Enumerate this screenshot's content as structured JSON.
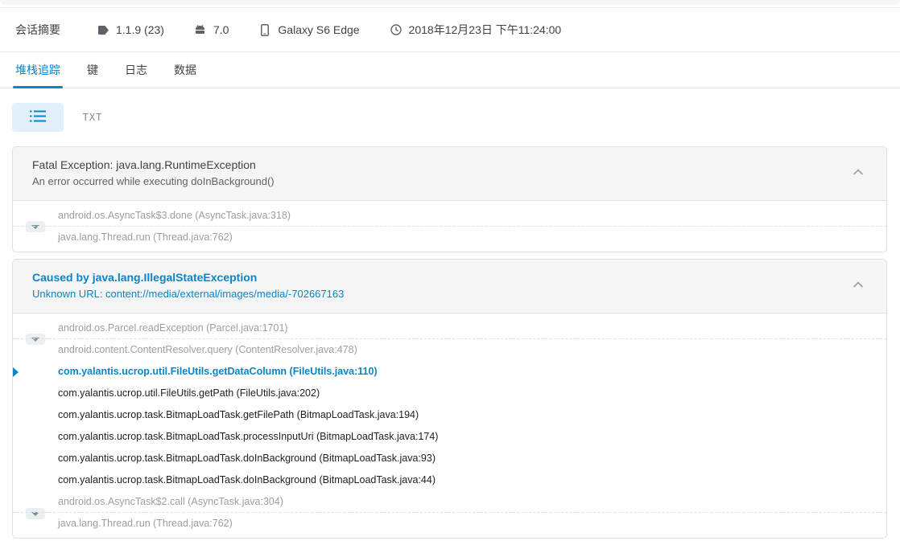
{
  "summary": {
    "title": "会话摘要",
    "version": "1.1.9 (23)",
    "os_version": "7.0",
    "device": "Galaxy S6 Edge",
    "datetime": "2018年12月23日 下午11:24:00",
    "icons": {
      "version": "tag-icon",
      "os": "android-icon",
      "device": "phone-icon",
      "time": "clock-icon"
    }
  },
  "tabs": [
    {
      "label": "堆栈追踪",
      "active": true
    },
    {
      "label": "键"
    },
    {
      "label": "日志"
    },
    {
      "label": "数据"
    }
  ],
  "view_toggle": {
    "list_icon": "list-icon",
    "txt_label": "TXT"
  },
  "exception1": {
    "title": "Fatal Exception: java.lang.RuntimeException",
    "message": "An error occurred while executing doInBackground()",
    "frames": [
      "android.os.AsyncTask$3.done (AsyncTask.java:318)",
      "java.lang.Thread.run (Thread.java:762)"
    ]
  },
  "exception2": {
    "title": "Caused by java.lang.IllegalStateException",
    "message": "Unknown URL: content://media/external/images/media/-702667163",
    "frames": [
      "android.os.Parcel.readException (Parcel.java:1701)",
      "android.content.ContentResolver.query (ContentResolver.java:478)",
      "com.yalantis.ucrop.util.FileUtils.getDataColumn (FileUtils.java:110)",
      "com.yalantis.ucrop.util.FileUtils.getPath (FileUtils.java:202)",
      "com.yalantis.ucrop.task.BitmapLoadTask.getFilePath (BitmapLoadTask.java:194)",
      "com.yalantis.ucrop.task.BitmapLoadTask.processInputUri (BitmapLoadTask.java:174)",
      "com.yalantis.ucrop.task.BitmapLoadTask.doInBackground (BitmapLoadTask.java:93)",
      "com.yalantis.ucrop.task.BitmapLoadTask.doInBackground (BitmapLoadTask.java:44)",
      "android.os.AsyncTask$2.call (AsyncTask.java:304)",
      "java.lang.Thread.run (Thread.java:762)"
    ]
  },
  "colors": {
    "accent": "#0a84c6",
    "muted": "#9e9e9e",
    "header_bg": "#f5f5f5"
  }
}
